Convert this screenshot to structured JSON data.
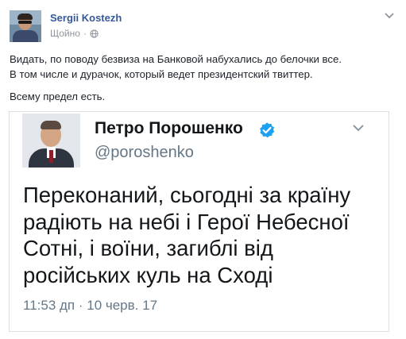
{
  "post": {
    "author": "Sergii Kostezh",
    "time": "Щойно",
    "separator": "·",
    "privacy_icon": "globe-icon",
    "menu_icon": "chevron-down-icon",
    "text_lines": [
      "Видать, по поводу безвиза на Банковой набухались до белочки все.",
      "В том числе и дурачок, который ведет президентский твиттер.",
      "Всему предел есть."
    ]
  },
  "tweet": {
    "name": "Петро Порошенко",
    "verified_icon": "verified-badge-icon",
    "handle": "@poroshenko",
    "menu_icon": "chevron-down-icon",
    "body_lines": [
      "Переконаний, сьогодні за країну",
      "радіють на небі і Герої Небесної",
      "Сотні, і воїни, загиблі від",
      "російських куль на Сході"
    ],
    "timestamp": "11:53 дп · 10 черв. 17"
  },
  "colors": {
    "author_link": "#365899",
    "meta_gray": "#90949c",
    "verified_blue": "#1da1f2",
    "tweet_gray": "#657786"
  }
}
